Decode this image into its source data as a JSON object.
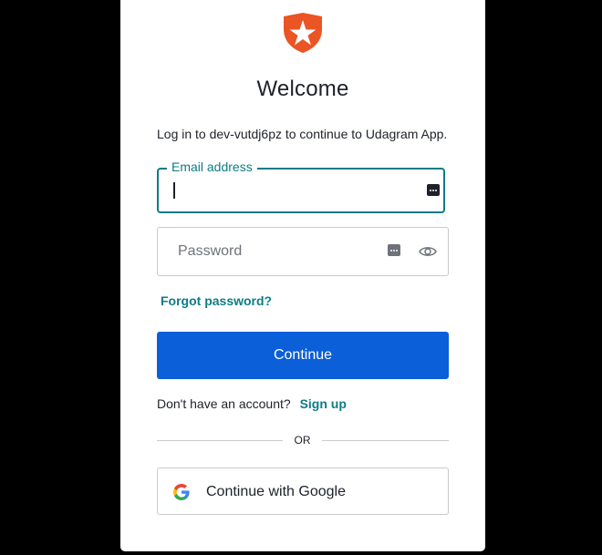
{
  "header": {
    "logo_icon": "auth0-star-shield-icon",
    "title": "Welcome",
    "subtitle": "Log in to dev-vutdj6pz to continue to Udagram App."
  },
  "form": {
    "email": {
      "label": "Email address",
      "value": ""
    },
    "password": {
      "placeholder": "Password",
      "value": ""
    },
    "forgot_password": "Forgot password?",
    "continue_label": "Continue"
  },
  "signup": {
    "prompt": "Don't have an account?",
    "link": "Sign up"
  },
  "divider": {
    "text": "OR"
  },
  "social": {
    "google_label": "Continue with Google",
    "google_icon": "google-g-icon"
  },
  "colors": {
    "brand_orange": "#eb5424",
    "accent_teal": "#0e7c86",
    "primary_button": "#0b5fd8",
    "text": "#1e212a",
    "border": "#c9cace",
    "background": "#000000"
  }
}
